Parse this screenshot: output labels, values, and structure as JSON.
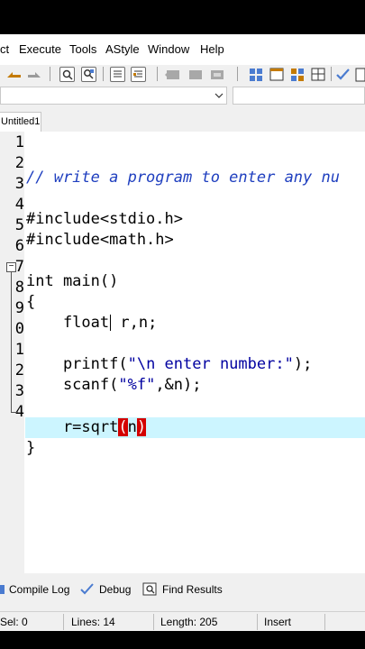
{
  "menu": [
    "ct",
    "Execute",
    "Tools",
    "AStyle",
    "Window",
    "Help"
  ],
  "tab_title": "Untitled1",
  "line_numbers": [
    "1",
    "2",
    "3",
    "4",
    "5",
    "6",
    "7",
    "8",
    "9",
    "0",
    "1",
    "2",
    "3",
    "4"
  ],
  "code": {
    "line1": "// write a program to enter any nu",
    "line3": "#include<stdio.h>",
    "line4": "#include<math.h>",
    "line6": "int main()",
    "line7": "{",
    "line8_a": "    float",
    "line8_b": " r,n;",
    "line10_a": "    printf(",
    "line10_b": "\"\\n enter number:\"",
    "line10_c": ");",
    "line11_a": "    scanf(",
    "line11_b": "\"%f\"",
    "line11_c": ",&n);",
    "line13_a": "    r=sqrt",
    "line13_b": "(",
    "line13_c": "n",
    "line13_d": ")",
    "line14": "}"
  },
  "bottom_tabs": {
    "compile_log": "Compile Log",
    "debug": "Debug",
    "find_results": "Find Results"
  },
  "status": {
    "sel": "Sel:    0",
    "lines": "Lines:   14",
    "length": "Length:  205",
    "mode": "Insert"
  },
  "colors": {
    "comment": "#1f3fbf",
    "current_line": "#ccf5ff",
    "paren_match": "#d40000"
  }
}
